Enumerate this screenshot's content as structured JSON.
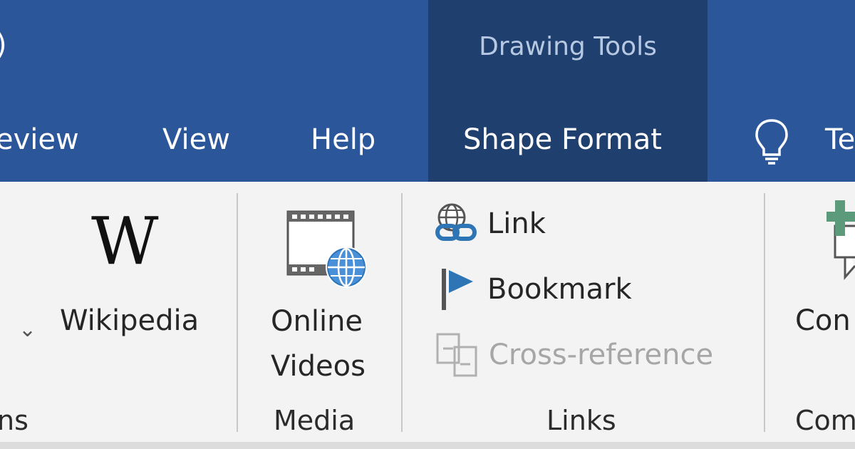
{
  "title_bar": {
    "paren_fragment": ")",
    "contextual_group": "Drawing Tools"
  },
  "tabs": {
    "review": "eview",
    "view": "View",
    "help": "Help",
    "shape_format": "Shape Format",
    "tell_me": "Te"
  },
  "ribbon": {
    "addins_partial": {
      "dropdown_glyph": "⌄",
      "group_label": "ns"
    },
    "wikipedia": {
      "logo_text": "W",
      "label": "Wikipedia"
    },
    "media": {
      "online_videos_line1": "Online",
      "online_videos_line2": "Videos",
      "group_label": "Media"
    },
    "links": {
      "link_label": "Link",
      "bookmark_label": "Bookmark",
      "cross_reference_label": "Cross-reference",
      "group_label": "Links"
    },
    "comments": {
      "button_label": "Con",
      "group_label": "Com"
    }
  },
  "colors": {
    "title_bar_bg": "#2b579a",
    "contextual_band_bg": "#1f3f6f",
    "ribbon_bg": "#f3f3f3",
    "link_icon_blue": "#2e75b6",
    "comment_plus_green": "#5b9a7a"
  }
}
